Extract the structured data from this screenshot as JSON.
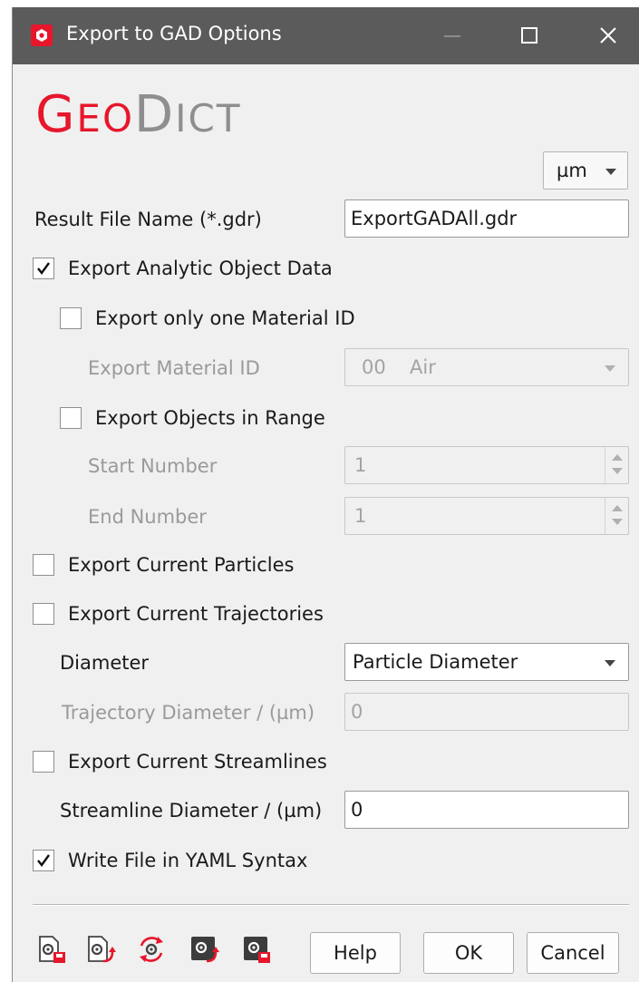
{
  "window": {
    "title": "Export to GAD Options",
    "logo_geo": "Geo",
    "logo_dict": "Dict"
  },
  "unit": {
    "selected": "µm"
  },
  "result_file": {
    "label": "Result File Name (*.gdr)",
    "value": "ExportGADAll.gdr"
  },
  "export_analytic": {
    "label": "Export Analytic Object Data",
    "checked": true
  },
  "export_one_material": {
    "label": "Export only one Material ID",
    "checked": false
  },
  "material_id": {
    "label": "Export Material ID",
    "code": "00",
    "name": "Air"
  },
  "export_range": {
    "label": "Export Objects in Range",
    "checked": false
  },
  "start_number": {
    "label": "Start Number",
    "value": "1"
  },
  "end_number": {
    "label": "End Number",
    "value": "1"
  },
  "export_particles": {
    "label": "Export Current Particles",
    "checked": false
  },
  "export_trajectories": {
    "label": "Export Current Trajectories",
    "checked": false
  },
  "diameter": {
    "label": "Diameter",
    "selected": "Particle Diameter"
  },
  "trajectory_diameter": {
    "label": "Trajectory Diameter / (µm)",
    "value": "0"
  },
  "export_streamlines": {
    "label": "Export Current Streamlines",
    "checked": false
  },
  "streamline_diameter": {
    "label": "Streamline Diameter / (µm)",
    "value": "0"
  },
  "write_yaml": {
    "label": "Write File in YAML Syntax",
    "checked": true
  },
  "toolbar_icons": [
    "load-settings-icon",
    "save-settings-icon",
    "reset-settings-icon",
    "macro-load-icon",
    "macro-save-icon"
  ],
  "buttons": {
    "help": "Help",
    "ok": "OK",
    "cancel": "Cancel"
  },
  "colors": {
    "accent": "#e7162b",
    "titlebar": "#5b5b5b",
    "background": "#f0f0f0"
  }
}
